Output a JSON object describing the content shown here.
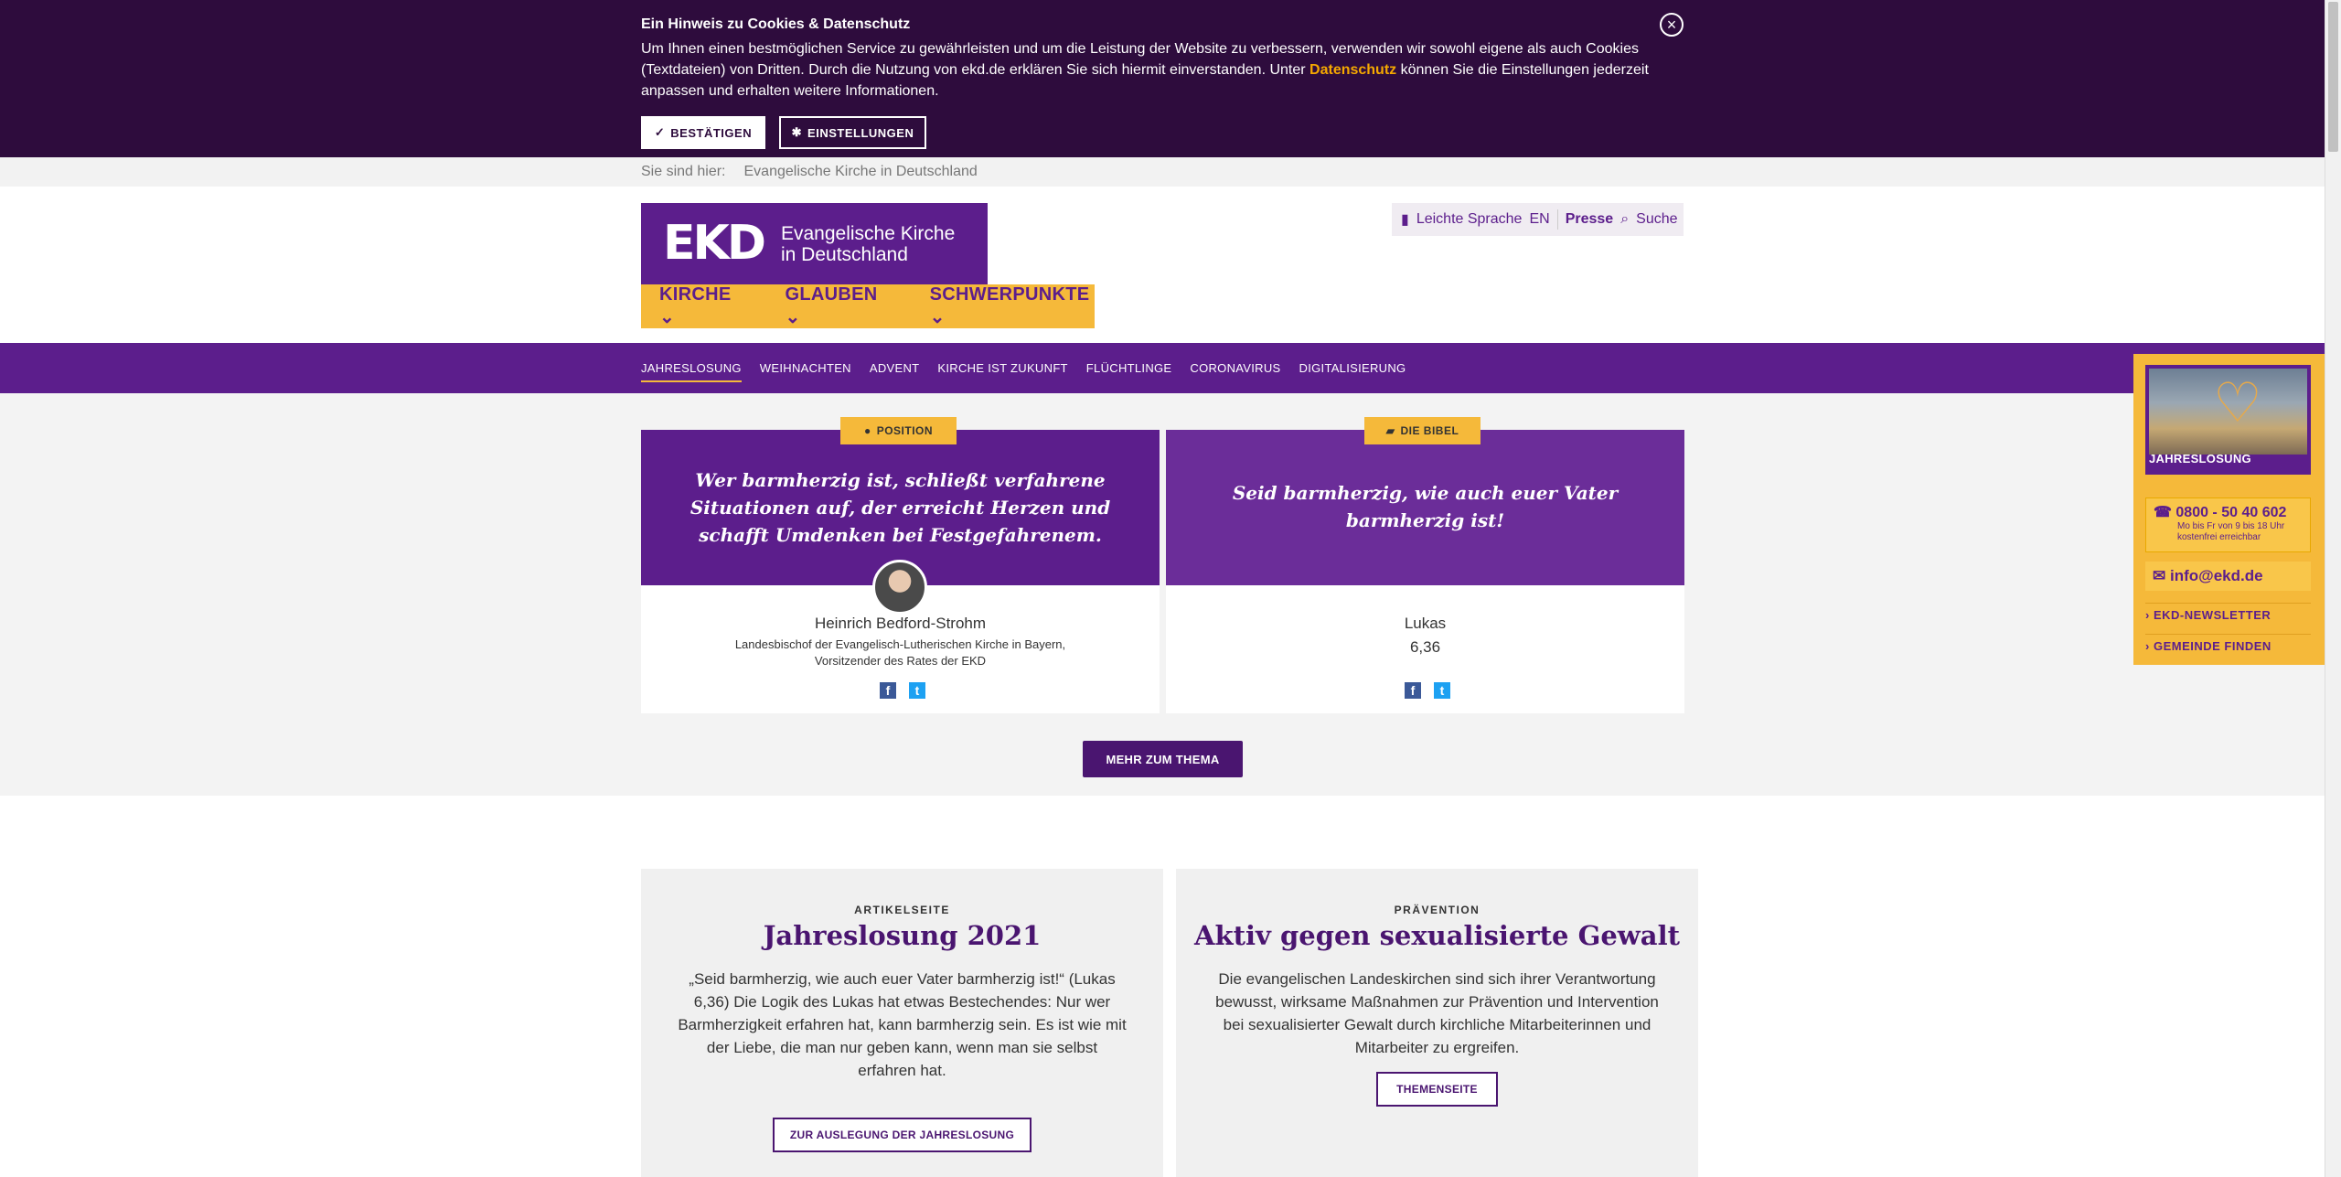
{
  "cookie": {
    "title": "Ein Hinweis zu Cookies & Datenschutz",
    "text_a": "Um Ihnen einen bestmöglichen Service zu gewährleisten und um die Leistung der Website zu verbessern, verwenden wir sowohl eigene als auch Cookies (Textdateien) von Dritten. Durch die Nutzung von ekd.de erklären Sie sich hiermit einverstanden. Unter ",
    "link": "Datenschutz",
    "text_b": " können Sie die Einstellungen jederzeit anpassen und erhalten weitere Informationen.",
    "confirm": "BESTÄTIGEN",
    "settings": "EINSTELLUNGEN",
    "close": "×"
  },
  "breadcrumb": {
    "label": "Sie sind hier:",
    "item": "Evangelische Kirche in Deutschland"
  },
  "logo": {
    "mark": "EKD",
    "line1": "Evangelische Kirche",
    "line2": "in Deutschland"
  },
  "mainnav": [
    "KIRCHE",
    "GLAUBEN",
    "SCHWERPUNKTE"
  ],
  "util": {
    "easy": "Leichte Sprache",
    "en": "EN",
    "press": "Presse",
    "search": "Suche"
  },
  "subnav": [
    "JAHRESLOSUNG",
    "WEIHNACHTEN",
    "ADVENT",
    "KIRCHE IST ZUKUNFT",
    "FLÜCHTLINGE",
    "CORONAVIRUS",
    "DIGITALISIERUNG"
  ],
  "widget": {
    "label": "JAHRESLOSUNG",
    "phone": "0800 - 50 40 602",
    "phone_hint1": "Mo bis Fr von 9 bis 18 Uhr",
    "phone_hint2": "kostenfrei erreichbar",
    "mail": "info@ekd.de",
    "newsletter": "EKD-NEWSLETTER",
    "gemeinde": "GEMEINDE FINDEN"
  },
  "quote1": {
    "tag": "POSITION",
    "text": "Wer barmherzig ist, schließt verfahrene Situationen auf, der erreicht Herzen und schafft Umdenken bei Festgefahrenem.",
    "author": "Heinrich Bedford-Strohm",
    "role1": "Landesbischof der Evangelisch-Lutherischen Kirche in Bayern,",
    "role2": "Vorsitzender des Rates der EKD"
  },
  "quote2": {
    "tag": "DIE BIBEL",
    "text": "Seid barmherzig, wie auch euer Vater barmherzig ist!",
    "book": "Lukas",
    "verse": "6,36"
  },
  "more_button": "MEHR ZUM THEMA",
  "article1": {
    "kicker": "ARTIKELSEITE",
    "title": "Jahreslosung 2021",
    "text": "„Seid barmherzig, wie auch euer Vater barmherzig ist!“ (Lukas 6,36) Die Logik des Lukas hat etwas Bestechendes: Nur wer Barmherzigkeit erfahren hat, kann barmherzig sein. Es ist wie mit der Liebe, die man nur geben kann, wenn man sie selbst erfahren hat.",
    "button": "ZUR AUSLEGUNG DER JAHRESLOSUNG"
  },
  "article2": {
    "kicker": "PRÄVENTION",
    "title": "Aktiv gegen sexualisierte Gewalt",
    "text": "Die evangelischen Landeskirchen sind sich ihrer Verantwortung bewusst, wirksame Maßnahmen zur Prävention und Intervention bei sexualisierter Gewalt durch kirchliche Mitarbeiterinnen und Mitarbeiter zu ergreifen.",
    "button": "THEMENSEITE"
  },
  "colors": {
    "purple": "#5c1e8c",
    "dark_purple": "#2e0c3d",
    "yellow": "#f5b93a",
    "accent_link": "#f5a800"
  }
}
